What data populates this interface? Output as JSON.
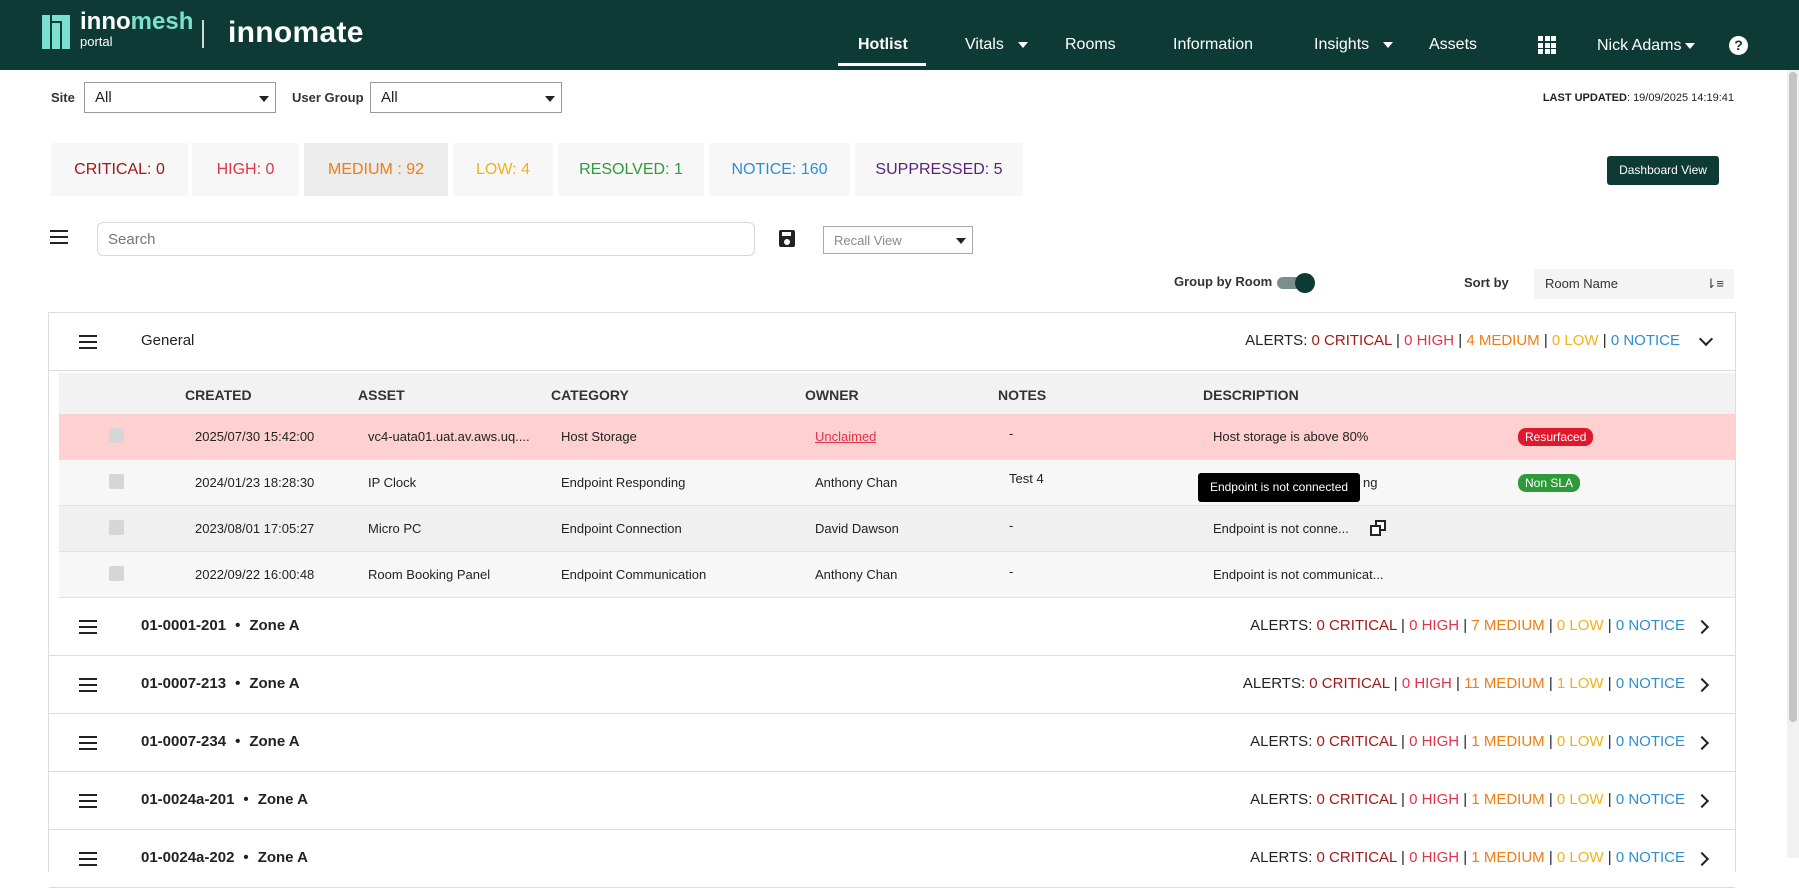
{
  "header": {
    "logo_primary_a": "inno",
    "logo_primary_b": "mesh",
    "logo_secondary": "portal",
    "brand": "innomate",
    "nav": [
      {
        "label": "Hotlist",
        "active": true
      },
      {
        "label": "Vitals",
        "dropdown": true
      },
      {
        "label": "Rooms"
      },
      {
        "label": "Information"
      },
      {
        "label": "Insights",
        "dropdown": true
      },
      {
        "label": "Assets"
      }
    ],
    "apps_icon": "grid-icon",
    "user": "Nick Adams",
    "help_icon": "help-icon",
    "help_glyph": "?"
  },
  "filters": {
    "site_label": "Site",
    "site_value": "All",
    "usergroup_label": "User Group",
    "usergroup_value": "All",
    "last_updated_label": "LAST UPDATED",
    "last_updated_value": ": 19/09/2025 14:19:41"
  },
  "summary": [
    {
      "label": "CRITICAL: 0",
      "color": "#a11818"
    },
    {
      "label": "HIGH: 0",
      "color": "#e0344a"
    },
    {
      "label": "MEDIUM : 92",
      "color": "#f07d12",
      "selected": true
    },
    {
      "label": "LOW: 4",
      "color": "#f0b21a"
    },
    {
      "label": "RESOLVED: 1",
      "color": "#2f9a3a"
    },
    {
      "label": "NOTICE: 160",
      "color": "#2b8fd0"
    },
    {
      "label": "SUPPRESSED: 5",
      "color": "#5a1f7a"
    }
  ],
  "dashboard_button": "Dashboard View",
  "toolbar": {
    "search_placeholder": "Search",
    "recall_view": "Recall View",
    "group_by_room_label": "Group by Room",
    "group_by_room_on": true,
    "sort_label": "Sort by",
    "sort_value": "Room Name",
    "sort_glyph": "⇂≡"
  },
  "general_group": {
    "title": "General",
    "alerts": {
      "prefix": "ALERTS: ",
      "critical": "0 CRITICAL",
      "high": "0 HIGH",
      "medium": "4 MEDIUM",
      "low": "0 LOW",
      "notice": "0 NOTICE"
    },
    "columns": [
      "CREATED",
      "ASSET",
      "CATEGORY",
      "OWNER",
      "NOTES",
      "DESCRIPTION"
    ],
    "rows": [
      {
        "created": "2025/07/30 15:42:00",
        "asset": "vc4-uata01.uat.av.aws.uq....",
        "category": "Host Storage",
        "owner": "Unclaimed",
        "notes": "-",
        "description": "Host storage is above 80%",
        "badge": "Resurfaced",
        "badge_color": "#e0182d",
        "highlight": "#ffd0d0"
      },
      {
        "created": "2024/01/23 18:28:30",
        "asset": "IP Clock",
        "category": "Endpoint Responding",
        "owner": "Anthony Chan",
        "notes": "Test 4",
        "description": "ng",
        "badge": "Non SLA",
        "badge_color": "#2f9a3a",
        "highlight": "#f7f7f7"
      },
      {
        "created": "2023/08/01 17:05:27",
        "asset": "Micro PC",
        "category": "Endpoint Connection",
        "owner": "David Dawson",
        "notes": "-",
        "description": "Endpoint is not conne...",
        "badge": "",
        "highlight": "#f0f0f0"
      },
      {
        "created": "2022/09/22 16:00:48",
        "asset": "Room Booking Panel",
        "category": "Endpoint Communication",
        "owner": "Anthony Chan",
        "notes": "-",
        "description": "Endpoint is not communicat...",
        "badge": "",
        "highlight": "#f7f7f7"
      }
    ],
    "tooltip": "Endpoint is not connected"
  },
  "room_groups": [
    {
      "room": "01-0001-201",
      "zone": "Zone A",
      "critical": "0 CRITICAL",
      "high": "0 HIGH",
      "medium": "7 MEDIUM",
      "low": "0 LOW",
      "notice": "0 NOTICE"
    },
    {
      "room": "01-0007-213",
      "zone": "Zone A",
      "critical": "0 CRITICAL",
      "high": "0 HIGH",
      "medium": "11 MEDIUM",
      "low": "1 LOW",
      "notice": "0 NOTICE"
    },
    {
      "room": "01-0007-234",
      "zone": "Zone A",
      "critical": "0 CRITICAL",
      "high": "0 HIGH",
      "medium": "1 MEDIUM",
      "low": "0 LOW",
      "notice": "0 NOTICE"
    },
    {
      "room": "01-0024a-201",
      "zone": "Zone A",
      "critical": "0 CRITICAL",
      "high": "0 HIGH",
      "medium": "1 MEDIUM",
      "low": "0 LOW",
      "notice": "0 NOTICE"
    },
    {
      "room": "01-0024a-202",
      "zone": "Zone A",
      "critical": "0 CRITICAL",
      "high": "0 HIGH",
      "medium": "1 MEDIUM",
      "low": "0 LOW",
      "notice": "0 NOTICE"
    }
  ],
  "alerts_prefix": "ALERTS: ",
  "sep": " | ",
  "bullet": "•"
}
